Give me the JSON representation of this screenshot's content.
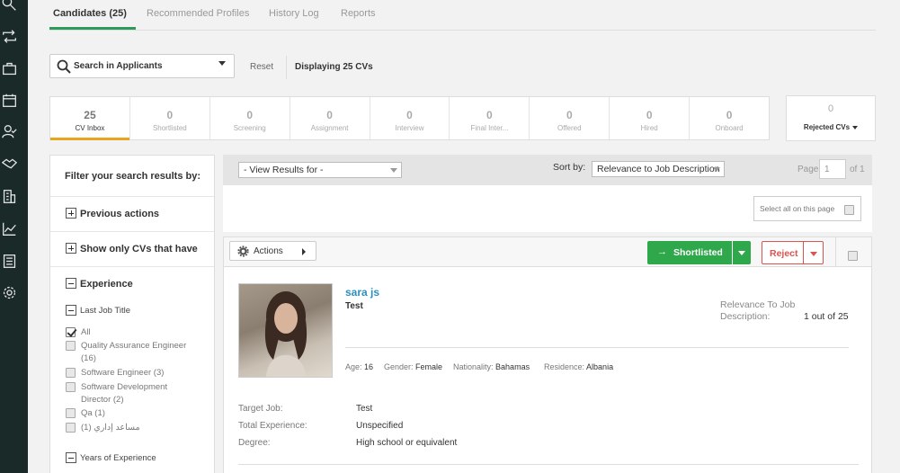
{
  "tabs": [
    {
      "label": "Candidates (25)"
    },
    {
      "label": "Recommended Profiles"
    },
    {
      "label": "History Log"
    },
    {
      "label": "Reports"
    }
  ],
  "search": {
    "label": "Search in Applicants",
    "reset": "Reset",
    "displaying": "Displaying 25 CVs"
  },
  "stages": [
    {
      "count": "25",
      "name": "CV Inbox"
    },
    {
      "count": "0",
      "name": "Shortlisted"
    },
    {
      "count": "0",
      "name": "Screening"
    },
    {
      "count": "0",
      "name": "Assignment"
    },
    {
      "count": "0",
      "name": "Interview"
    },
    {
      "count": "0",
      "name": "Final Inter..."
    },
    {
      "count": "0",
      "name": "Offered"
    },
    {
      "count": "0",
      "name": "Hired"
    },
    {
      "count": "0",
      "name": "Onboard"
    }
  ],
  "rejected": {
    "count": "0",
    "name": "Rejected CVs"
  },
  "filter": {
    "header": "Filter your search results by:",
    "previous_actions": "Previous actions",
    "show_only": "Show only CVs that have",
    "experience": "Experience",
    "last_job_title": "Last Job Title",
    "options": [
      {
        "label": "All",
        "checked": true
      },
      {
        "label": "Quality Assurance Engineer (16)",
        "checked": false
      },
      {
        "label": "Software Engineer (3)",
        "checked": false
      },
      {
        "label": "Software Development Director (2)",
        "checked": false
      },
      {
        "label": "Qa (1)",
        "checked": false
      },
      {
        "label": "مساعد إداري (1)",
        "checked": false
      }
    ],
    "years_of_experience": "Years of Experience"
  },
  "results": {
    "view_results": "- View Results for -",
    "sort_by_label": "Sort by:",
    "sort_by_value": "Relevance to Job Description",
    "page_label": "Page",
    "page_value": "1",
    "page_of": "of 1",
    "select_all": "Select all on this page"
  },
  "card": {
    "actions": "Actions",
    "shortlisted": "Shortlisted",
    "reject": "Reject",
    "name": "sara js",
    "title": "Test",
    "relevance_label": "Relevance To Job Description:",
    "relevance_value": "1 out of 25",
    "meta": [
      {
        "k": "Age:",
        "v": "16"
      },
      {
        "k": "Gender:",
        "v": "Female"
      },
      {
        "k": "Nationality:",
        "v": "Bahamas"
      },
      {
        "k": "Residence:",
        "v": "Albania"
      }
    ],
    "details": [
      {
        "k": "Target Job:",
        "v": "Test"
      },
      {
        "k": "Total Experience:",
        "v": "Unspecified"
      },
      {
        "k": "Degree:",
        "v": "High school or equivalent"
      }
    ]
  },
  "colors": {
    "accent_green": "#2ea84a",
    "reject_red": "#d9534f",
    "active_tab": "#2b9a5a",
    "active_stage": "#e8a41f",
    "link_blue": "#2b8fbf"
  }
}
